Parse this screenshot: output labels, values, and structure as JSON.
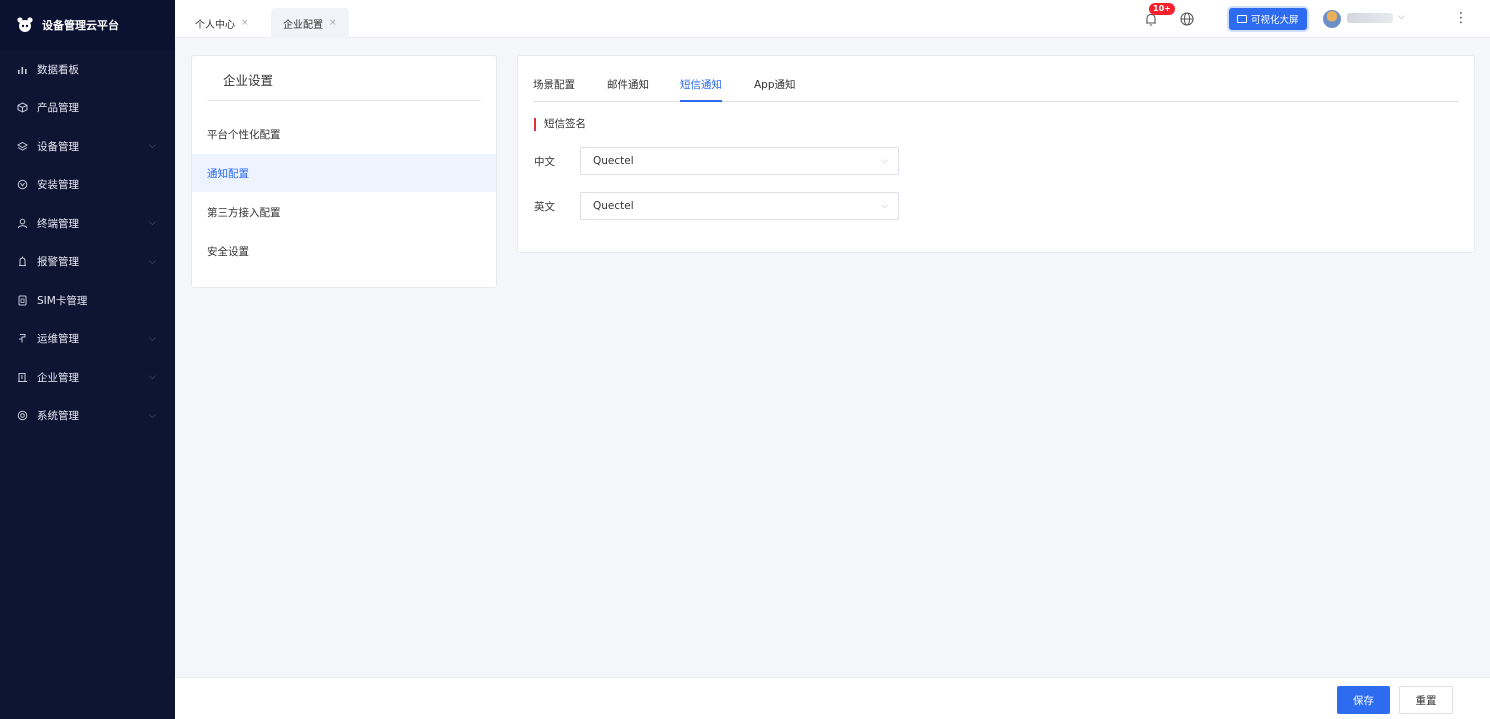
{
  "app": {
    "title": "设备管理云平台"
  },
  "sidebar": {
    "items": [
      {
        "label": "数据看板",
        "icon": "bar-chart-icon",
        "has_arrow": false
      },
      {
        "label": "产品管理",
        "icon": "cube-icon",
        "has_arrow": false
      },
      {
        "label": "设备管理",
        "icon": "layers-icon",
        "has_arrow": true
      },
      {
        "label": "安装管理",
        "icon": "install-icon",
        "has_arrow": false
      },
      {
        "label": "终端管理",
        "icon": "user-icon",
        "has_arrow": true
      },
      {
        "label": "报警管理",
        "icon": "alarm-icon",
        "has_arrow": true
      },
      {
        "label": "SIM卡管理",
        "icon": "sim-card-icon",
        "has_arrow": false
      },
      {
        "label": "运维管理",
        "icon": "maintenance-icon",
        "has_arrow": true
      },
      {
        "label": "企业管理",
        "icon": "building-icon",
        "has_arrow": true
      },
      {
        "label": "系统管理",
        "icon": "settings-icon",
        "has_arrow": true
      }
    ]
  },
  "topbar": {
    "tabs": [
      {
        "label": "个人中心",
        "close": "×",
        "active": false
      },
      {
        "label": "企业配置",
        "close": "×",
        "active": true
      }
    ],
    "notification_badge": "10+",
    "bigscreen_label": "可视化大屏",
    "username": "",
    "more_icon": "⋮"
  },
  "settings_panel": {
    "title": "企业设置",
    "items": [
      {
        "label": "平台个性化配置",
        "active": false
      },
      {
        "label": "通知配置",
        "active": true
      },
      {
        "label": "第三方接入配置",
        "active": false
      },
      {
        "label": "安全设置",
        "active": false
      }
    ]
  },
  "content": {
    "tabs": [
      {
        "label": "场景配置",
        "active": false
      },
      {
        "label": "邮件通知",
        "active": false
      },
      {
        "label": "短信通知",
        "active": true
      },
      {
        "label": "App通知",
        "active": false
      }
    ],
    "section_title": "短信签名",
    "fields": [
      {
        "label": "中文",
        "value": "Quectel"
      },
      {
        "label": "英文",
        "value": "Quectel"
      }
    ]
  },
  "footer": {
    "save_label": "保存",
    "reset_label": "重置"
  },
  "colors": {
    "primary": "#2d6cf1",
    "sidebar_bg": "#0e1532",
    "accent_red": "#e0303a",
    "badge_red": "#f5222d"
  }
}
